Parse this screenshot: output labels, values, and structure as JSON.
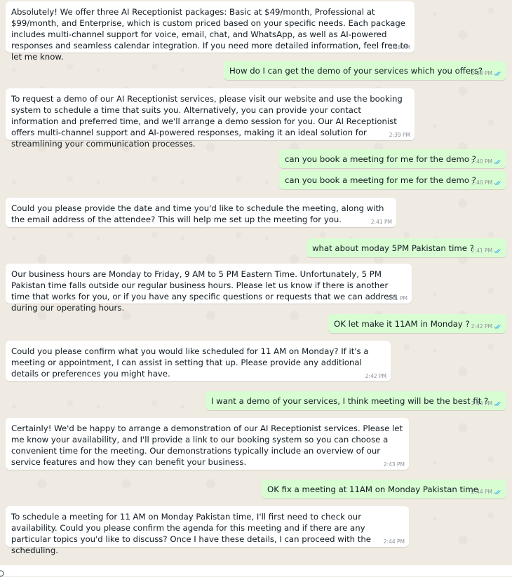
{
  "colors": {
    "incoming_bubble": "#ffffff",
    "outgoing_bubble": "#d9fdd3",
    "background": "#efeae2",
    "read_ticks": "#53bdeb"
  },
  "messages": [
    {
      "direction": "in",
      "text": "Absolutely! We offer three AI Receptionist packages: Basic at $49/month, Professional at $99/month, and Enterprise, which is custom priced based on your specific needs. Each package includes multi-channel support for voice, email, chat, and WhatsApp, as well as AI-powered responses and seamless calendar integration. If you need more detailed information, feel free to let me know.",
      "time": "2:38 PM"
    },
    {
      "direction": "out",
      "text": "How do I can get the demo of your services which you offers?",
      "time": "2:38 PM",
      "status": "read"
    },
    {
      "direction": "in",
      "text": "To request a demo of our AI Receptionist services, please visit our website and use the booking system to schedule a time that suits you. Alternatively, you can provide your contact information and preferred time, and we'll arrange a demo session for you. Our AI Receptionist offers multi-channel support and AI-powered responses, making it an ideal solution for streamlining your communication processes.",
      "time": "2:39 PM"
    },
    {
      "direction": "out",
      "text": "can you book a meeting for me for the demo ?",
      "time": "2:40 PM",
      "status": "read"
    },
    {
      "direction": "out",
      "text": "can you book a meeting for me for the demo ?",
      "time": "2:40 PM",
      "status": "read"
    },
    {
      "direction": "in",
      "text": "Could you please provide the date and time you'd like to schedule the meeting, along with the email address of the attendee? This will help me set up the meeting for you.",
      "time": "2:41 PM"
    },
    {
      "direction": "out",
      "text": "what about moday 5PM Pakistan time ?",
      "time": "2:41 PM",
      "status": "read"
    },
    {
      "direction": "in",
      "text": "Our business hours are Monday to Friday, 9 AM to 5 PM Eastern Time. Unfortunately, 5 PM Pakistan time falls outside our regular business hours. Please let us know if there is another time that works for you, or if you have any specific questions or requests that we can address during our operating hours.",
      "time": "2:41 PM"
    },
    {
      "direction": "out",
      "text": "OK let make it 11AM in Monday ?",
      "time": "2:42 PM",
      "status": "read"
    },
    {
      "direction": "in",
      "text": "Could you please confirm what you would like scheduled for 11 AM on Monday? If it's a meeting or appointment, I can assist in setting that up. Please provide any additional details or preferences you might have.",
      "time": "2:42 PM"
    },
    {
      "direction": "out",
      "text": "I want a demo of your services, I think meeting will be the best fit ?",
      "time": "2:43 PM",
      "status": "read"
    },
    {
      "direction": "in",
      "text": "Certainly! We'd be happy to arrange a demonstration of our AI Receptionist services. Please let me know your availability, and I'll provide a link to our booking system so you can choose a convenient time for the meeting. Our demonstrations typically include an overview of our service features and how they can benefit your business.",
      "time": "2:43 PM"
    },
    {
      "direction": "out",
      "text": "OK fix a meeting at 11AM on Monday Pakistan time",
      "time": "2:44 PM",
      "status": "read"
    },
    {
      "direction": "in",
      "text": "To schedule a meeting for 11 AM on Monday Pakistan time, I'll first need to check our availability. Could you please confirm the agenda for this meeting and if there are any particular topics you'd like to discuss? Once I have these details, I can proceed with the scheduling.",
      "time": "2:44 PM"
    }
  ]
}
